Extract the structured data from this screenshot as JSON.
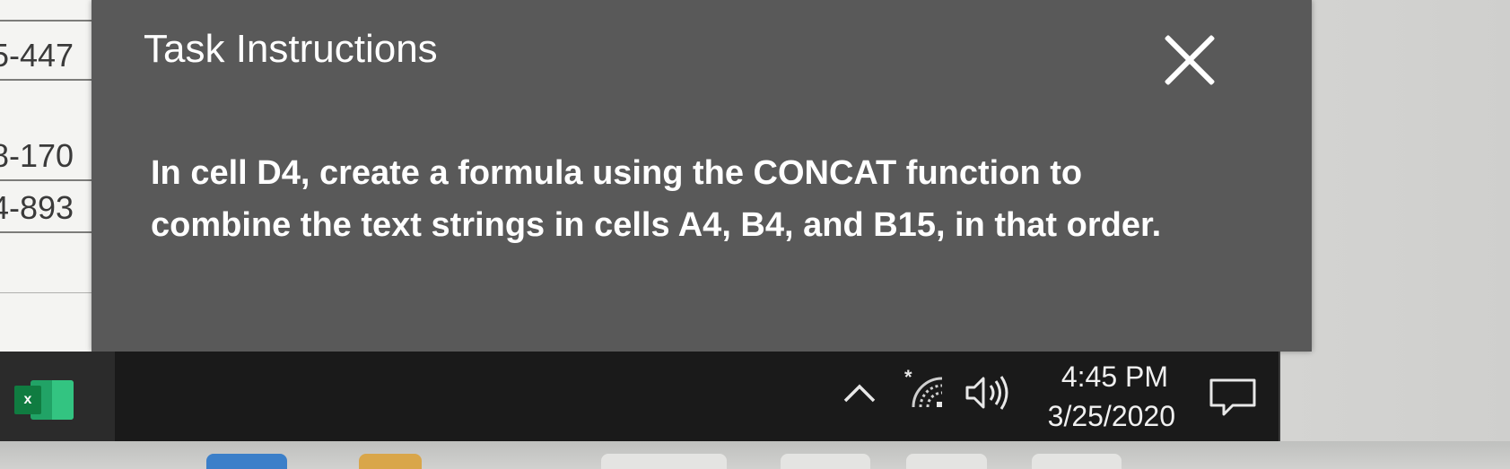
{
  "spreadsheet": {
    "cells": [
      "",
      "5-447",
      "",
      "8-170",
      "4-893",
      ""
    ]
  },
  "task_panel": {
    "title": "Task Instructions",
    "close_icon": "close-icon",
    "instructions": "In cell D4, create a formula using the CONCAT function to combine the text strings in cells A4, B4, and B15, in that order."
  },
  "taskbar": {
    "app_icon": "excel-icon",
    "tray_icons": [
      "chevron-up-icon",
      "wifi-icon",
      "volume-icon",
      "notification-icon"
    ],
    "time": "4:45 PM",
    "date": "3/25/2020"
  },
  "colors": {
    "panel_bg": "#595959",
    "taskbar_bg": "#1a1a1a",
    "excel_green": "#107c41"
  }
}
